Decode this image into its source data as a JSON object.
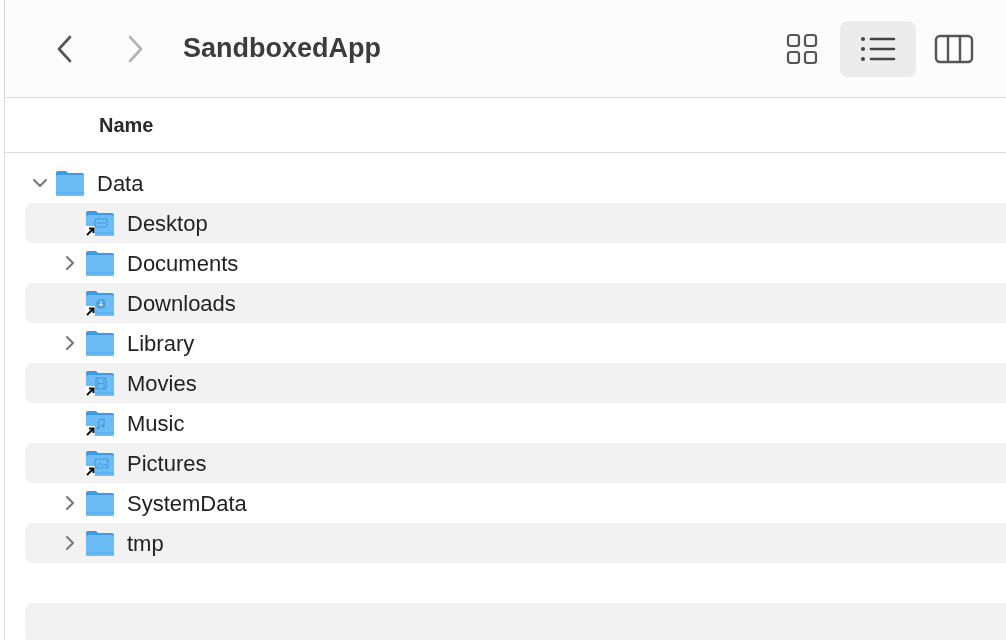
{
  "toolbar": {
    "back": {
      "disabled": false
    },
    "forward": {
      "disabled": true
    },
    "title": "SandboxedApp",
    "views": [
      {
        "kind": "icons",
        "selected": false
      },
      {
        "kind": "list",
        "selected": true
      },
      {
        "kind": "columns",
        "selected": false
      }
    ]
  },
  "table": {
    "columns": [
      "Name"
    ],
    "rows": [
      {
        "name": "Data",
        "kind": "folder",
        "expanded": true,
        "children": [
          {
            "name": "Desktop",
            "kind": "desktop-alias"
          },
          {
            "name": "Documents",
            "kind": "folder",
            "expanded": false
          },
          {
            "name": "Downloads",
            "kind": "downloads-alias"
          },
          {
            "name": "Library",
            "kind": "folder",
            "expanded": false
          },
          {
            "name": "Movies",
            "kind": "movies-alias"
          },
          {
            "name": "Music",
            "kind": "music-alias"
          },
          {
            "name": "Pictures",
            "kind": "pictures-alias"
          },
          {
            "name": "SystemData",
            "kind": "folder",
            "expanded": false
          },
          {
            "name": "tmp",
            "kind": "folder",
            "expanded": false
          }
        ]
      }
    ]
  }
}
